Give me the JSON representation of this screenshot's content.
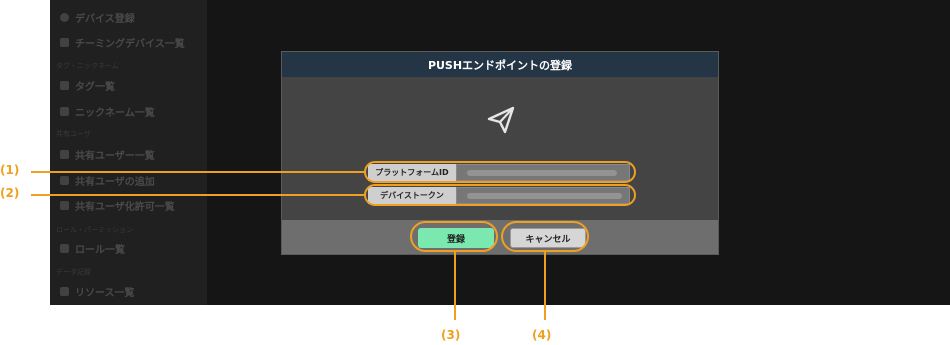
{
  "sidebar": {
    "items": [
      {
        "label": "デバイス登録",
        "icon": "plus-circle-icon"
      },
      {
        "label": "チーミングデバイス一覧",
        "icon": "devices-icon"
      },
      {
        "section": "タグ・ニックネーム"
      },
      {
        "label": "タグ一覧",
        "icon": "tag-icon"
      },
      {
        "label": "ニックネーム一覧",
        "icon": "pencil-icon"
      },
      {
        "section": "共有ユーザ"
      },
      {
        "label": "共有ユーザー一覧",
        "icon": "user-icon"
      },
      {
        "label": "共有ユーザの追加",
        "icon": "user-plus-icon"
      },
      {
        "label": "共有ユーザ化許可一覧",
        "icon": "unlock-icon"
      },
      {
        "section": "ロール・パーミッション"
      },
      {
        "label": "ロール一覧",
        "icon": "users-icon"
      },
      {
        "section": "データ記録"
      },
      {
        "label": "リソース一覧",
        "icon": "database-icon"
      }
    ]
  },
  "modal": {
    "title": "PUSHエンドポイントの登録",
    "icon": "paper-plane-icon",
    "fields": [
      {
        "label": "プラットフォームID"
      },
      {
        "label": "デバイストークン"
      }
    ],
    "register_label": "登録",
    "cancel_label": "キャンセル"
  },
  "callouts": {
    "c1": "(1)",
    "c2": "(2)",
    "c3": "(3)",
    "c4": "(4)"
  },
  "colors": {
    "accent": "#f0a020",
    "header": "#243646",
    "register_button": "#7be8b0"
  }
}
